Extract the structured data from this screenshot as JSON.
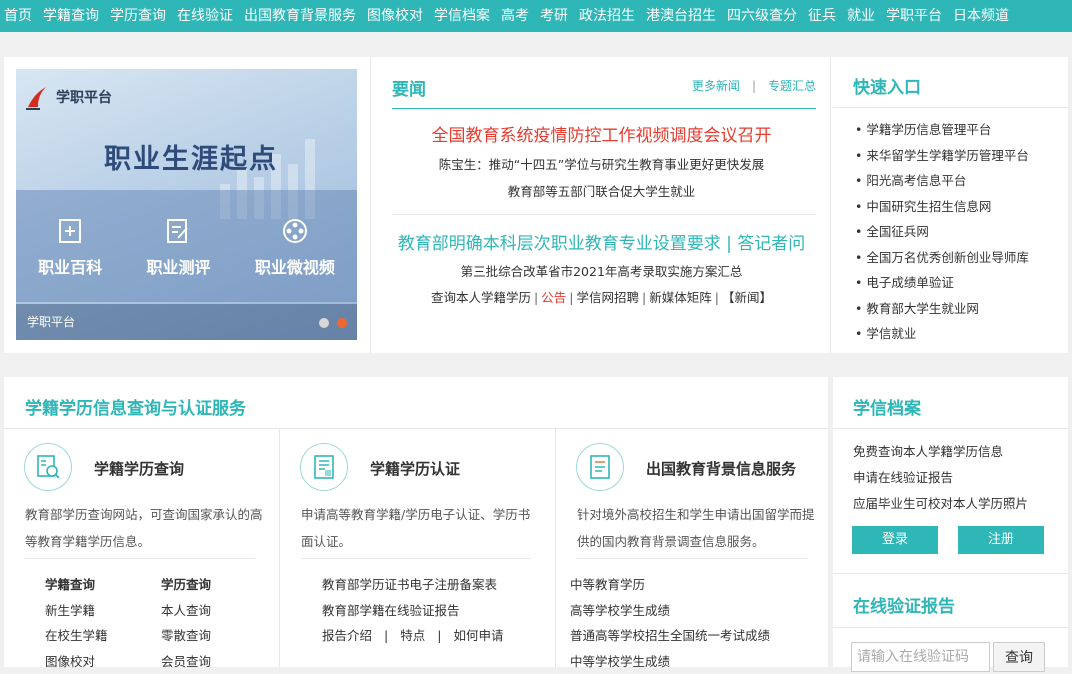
{
  "nav": {
    "items": [
      "首页",
      "学籍查询",
      "学历查询",
      "在线验证",
      "出国教育背景服务",
      "图像校对",
      "学信档案",
      "高考",
      "考研",
      "政法招生",
      "港澳台招生",
      "四六级查分",
      "征兵",
      "就业",
      "学职平台",
      "日本频道"
    ]
  },
  "banner": {
    "logo_text": "学职平台",
    "slogan": "职业生涯起点",
    "features": [
      "职业百科",
      "职业测评",
      "职业微视频"
    ],
    "caption": "学职平台"
  },
  "news": {
    "title": "要闻",
    "more_label": "更多新闻",
    "topics_label": "专题汇总",
    "headline1": "全国教育系统疫情防控工作视频调度会议召开",
    "headline1_sub1": "陈宝生：推动“十四五”学位与研究生教育事业更好更快发展",
    "headline1_sub2": "教育部等五部门联合促大学生就业",
    "headline2": "教育部明确本科层次职业教育专业设置要求 | 答记者问",
    "headline2_sub1": "第三批综合改革省市2021年高考录取实施方案汇总",
    "headline2_links": [
      "查询本人学籍学历",
      "公告",
      "学信网招聘",
      "新媒体矩阵",
      "【新闻】"
    ]
  },
  "quick": {
    "title": "快速入口",
    "items": [
      "学籍学历信息管理平台",
      "来华留学生学籍学历管理平台",
      "阳光高考信息平台",
      "中国研究生招生信息网",
      "全国征兵网",
      "全国万名优秀创新创业导师库",
      "电子成绩单验证",
      "教育部大学生就业网",
      "学信就业"
    ]
  },
  "service": {
    "title": "学籍学历信息查询与认证服务",
    "col1": {
      "name": "学籍学历查询",
      "desc": "教育部学历查询网站，可查询国家承认的高等教育学籍学历信息。",
      "links": [
        "学籍查询",
        "学历查询",
        "新生学籍",
        "本人查询",
        "在校生学籍",
        "零散查询",
        "图像校对",
        "会员查询"
      ]
    },
    "col2": {
      "name": "学籍学历认证",
      "desc": "申请高等教育学籍/学历电子认证、学历书面认证。",
      "links": [
        "教育部学历证书电子注册备案表",
        "教育部学籍在线验证报告"
      ],
      "sublinks": [
        "报告介绍",
        "特点",
        "如何申请"
      ]
    },
    "col3": {
      "name": "出国教育背景信息服务",
      "desc": "针对境外高校招生和学生申请出国留学而提供的国内教育背景调查信息服务。",
      "links": [
        "中等教育学历",
        "高等学校学生成绩",
        "普通高等学校招生全国统一考试成绩",
        "中等学校学生成绩"
      ]
    }
  },
  "archive": {
    "title": "学信档案",
    "items": [
      "免费查询本人学籍学历信息",
      "申请在线验证报告",
      "应届毕业生可校对本人学历照片"
    ],
    "login_label": "登录",
    "register_label": "注册"
  },
  "verify": {
    "title": "在线验证报告",
    "placeholder": "请输入在线验证码",
    "query_label": "查询"
  },
  "colors": {
    "accent": "#2fb6b7",
    "headline_red": "#e63b2e",
    "dot_active": "#f2672a"
  }
}
